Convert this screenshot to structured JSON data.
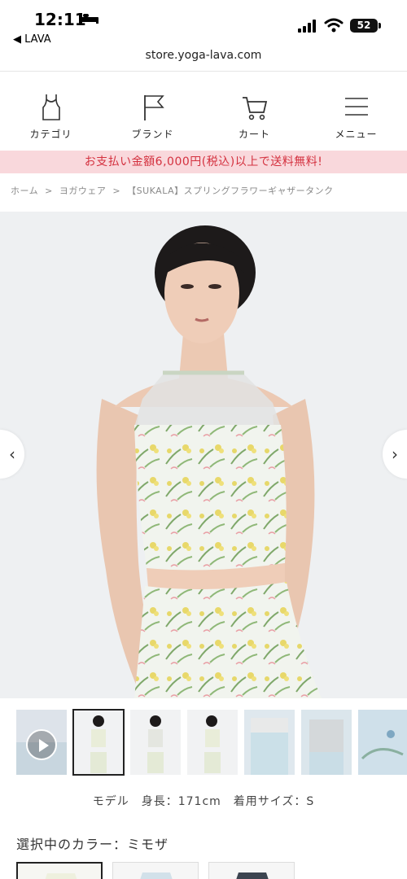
{
  "status_bar": {
    "time": "12:11",
    "back_app": "◀ LAVA",
    "battery": "52",
    "url": "store.yoga-lava.com"
  },
  "nav": [
    {
      "label": "カテゴリ",
      "icon": "tank-top-icon"
    },
    {
      "label": "ブランド",
      "icon": "flag-icon"
    },
    {
      "label": "カート",
      "icon": "cart-icon"
    },
    {
      "label": "メニュー",
      "icon": "hamburger-menu-icon"
    }
  ],
  "banner": "お支払い金額6,000円(税込)以上で送料無料!",
  "breadcrumb": [
    "ホーム",
    ">",
    "ヨガウェア",
    ">",
    "【SUKALA】スプリングフラワーギャザータンク"
  ],
  "product_image": {
    "prev_icon": "chevron-left-icon",
    "next_icon": "chevron-right-icon"
  },
  "model_info": "モデル　身長：171cm　着用サイズ：S",
  "color_selection": "選択中のカラー：ミモザ",
  "colors": {
    "accent_pink": "#f9d8dc",
    "accent_red": "#d4313f"
  }
}
